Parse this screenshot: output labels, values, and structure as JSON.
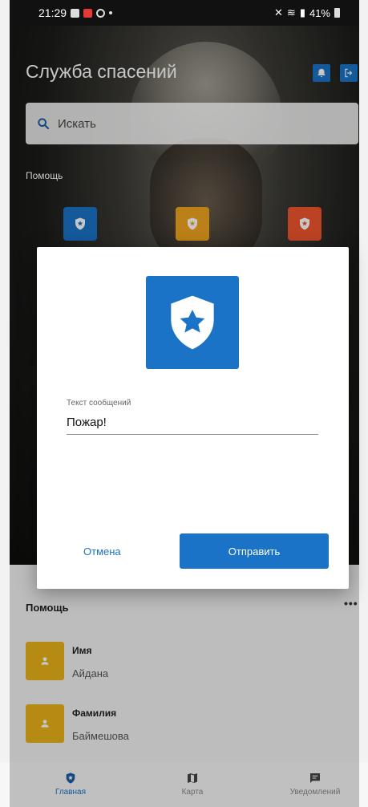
{
  "status_bar": {
    "time": "21:29",
    "battery": "41%"
  },
  "header": {
    "title": "Служба спасений"
  },
  "search": {
    "placeholder": "Искать"
  },
  "help_section": {
    "title": "Помощь"
  },
  "list_section": {
    "title": "Помощь",
    "more": "•••",
    "contacts": [
      {
        "label": "Имя",
        "value": "Айдана"
      },
      {
        "label": "Фамилия",
        "value": "Баймешова"
      }
    ]
  },
  "dialog": {
    "field_label": "Текст сообщений",
    "field_value": "Пожар!",
    "cancel_label": "Отмена",
    "send_label": "Отправить"
  },
  "nav": {
    "items": [
      {
        "label": "Главная"
      },
      {
        "label": "Карта"
      },
      {
        "label": "Уведомлений"
      }
    ]
  },
  "colors": {
    "accent": "#1a73c6",
    "yellow": "#e8b21a",
    "orange": "#f0a51e",
    "red": "#f0552e"
  },
  "icons": [
    "bell-icon",
    "logout-icon",
    "search-icon",
    "shield-star-icon",
    "person-icon",
    "map-icon",
    "message-icon"
  ]
}
